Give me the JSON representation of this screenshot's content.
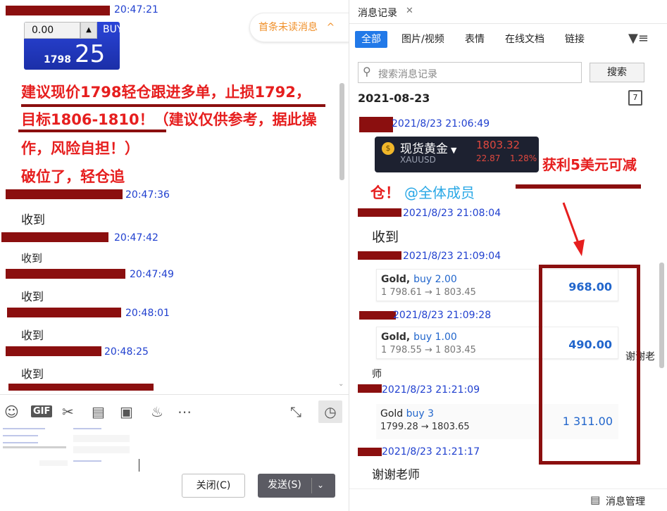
{
  "left": {
    "timestamps": [
      "20:47:21",
      "20:47:36",
      "20:47:42",
      "20:47:49",
      "20:48:01",
      "20:48:25"
    ],
    "widget": {
      "qty": "0.00",
      "up": "▲",
      "buy": "BUY",
      "price_small": "1798",
      "price_big": "25"
    },
    "unread": {
      "label": "首条未读消息",
      "icon": "double-chevron-up-icon"
    },
    "advice": {
      "line1": "建议现价1798轻仓跟进多单，止损1792，",
      "line2": "目标1806-1810！（建议仅供参考，据此操",
      "line3": "作，风险自担！）",
      "line4": "破位了，轻仓追"
    },
    "replies": [
      "收到",
      "收到",
      "收到",
      "收到",
      "收到"
    ],
    "toolbar_icons": [
      "smile-icon",
      "gif-icon",
      "scissors-icon",
      "folder-icon",
      "image-icon",
      "bell-icon",
      "more-icon",
      "expand-icon",
      "clock-icon"
    ],
    "close_label": "关闭(C)",
    "send_label": "发送(S)"
  },
  "right": {
    "tab_title": "消息记录",
    "filters": [
      "全部",
      "图片/视频",
      "表情",
      "在线文档",
      "链接"
    ],
    "search_placeholder": "搜索消息记录",
    "search_button": "搜索",
    "date": "2021-08-23",
    "calendar_label": "7",
    "quote": {
      "name": "现货黄金",
      "code": "XAUUSD",
      "price": "1803.32",
      "change": "22.87",
      "percent": "1.28%"
    },
    "annotation": "获利5美元可减",
    "messages": {
      "t1": "2021/8/23 21:06:49",
      "m1_a": "仓！",
      "m1_b": "@全体成员",
      "t2": "2021/8/23 21:08:04",
      "m2": "收到",
      "t3": "2021/8/23 21:09:04",
      "t4": "2021/8/23 21:09:28",
      "thanks_a": "谢谢老",
      "thanks_b": "师",
      "t5": "2021/8/23 21:21:09",
      "t6": "2021/8/23 21:21:17",
      "m6": "谢谢老师"
    },
    "cards": [
      {
        "sym": "Gold,",
        "side": "buy 2.00",
        "route": "1 798.61 → 1 803.45",
        "amount": "968.00"
      },
      {
        "sym": "Gold,",
        "side": "buy 1.00",
        "route": "1 798.55 → 1 803.45",
        "amount": "490.00"
      },
      {
        "sym": "Gold",
        "side": "buy 3",
        "route": "1799.28 → 1803.65",
        "amount": "1 311.00"
      }
    ],
    "footer_label": "消息管理"
  }
}
